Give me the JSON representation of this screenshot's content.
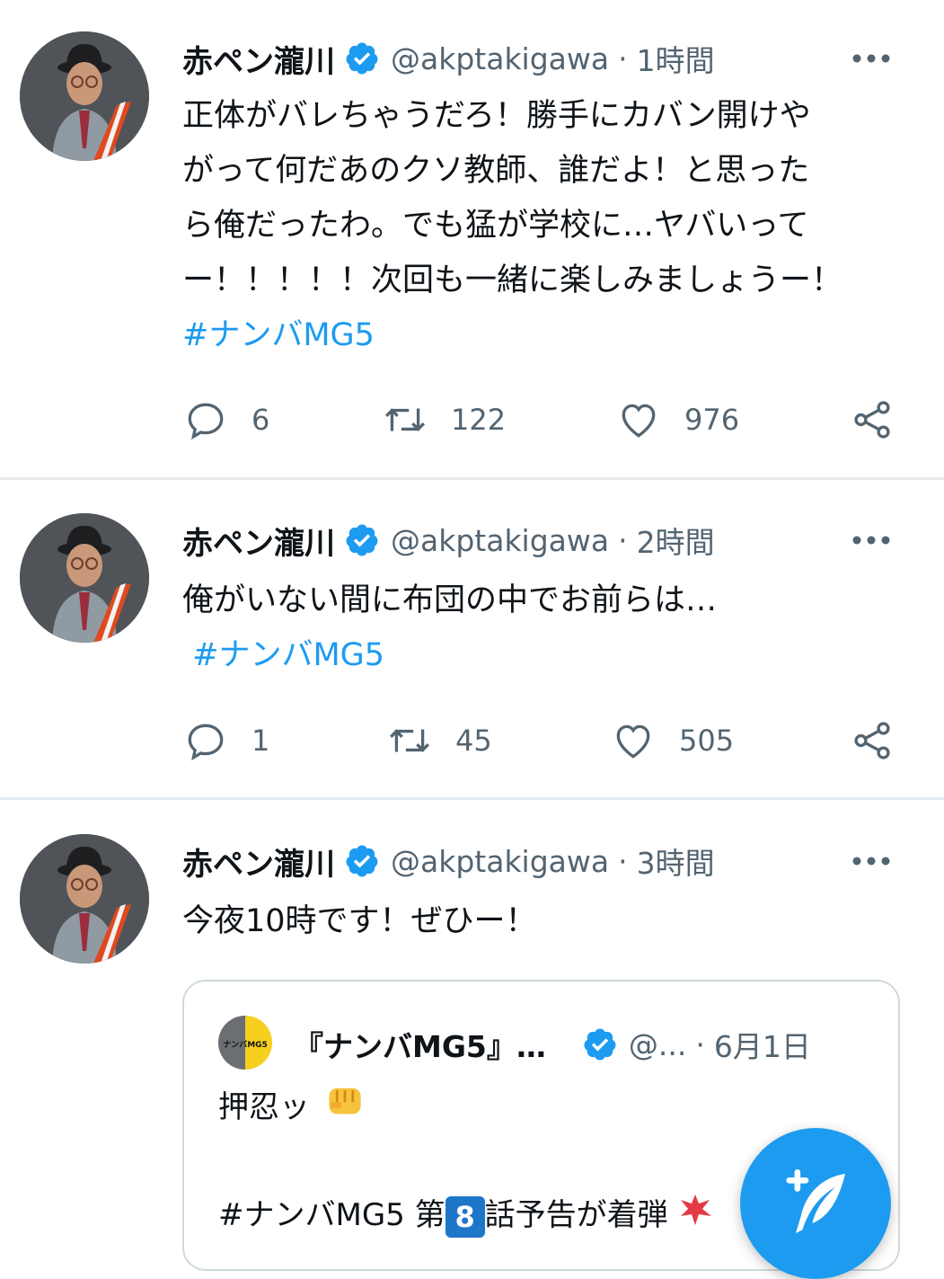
{
  "colors": {
    "accent": "#1d9bf0",
    "text": "#0f1419",
    "muted": "#536471",
    "divider": "#e6ecf0"
  },
  "tweets": [
    {
      "name": "赤ペン瀧川",
      "handle": "@akptakigawa",
      "sep": "·",
      "time": "1時間",
      "lines": [
        "正体がバレちゃうだろ！勝手にカバン開けや",
        "がって何だあのクソ教師、誰だよ！と思った",
        "ら俺だったわ。でも猛が学校に…ヤバいって",
        "ー！！！！！次回も一緒に楽しみましょうー！"
      ],
      "hashtag": "#ナンバMG5",
      "replies": "6",
      "retweets": "122",
      "likes": "976"
    },
    {
      "name": "赤ペン瀧川",
      "handle": "@akptakigawa",
      "sep": "·",
      "time": "2時間",
      "lines": [
        "俺がいない間に布団の中でお前らは…"
      ],
      "hashtag": " #ナンバMG5",
      "replies": "1",
      "retweets": "45",
      "likes": "505"
    },
    {
      "name": "赤ペン瀧川",
      "handle": "@akptakigawa",
      "sep": "·",
      "time": "3時間",
      "lines": [
        "今夜10時です！ぜひー！"
      ],
      "quote": {
        "name": "『ナンバMG5』…",
        "handle": "@...",
        "sep": "·",
        "time": "6月1日",
        "line1": "押忍ッ",
        "line2_prefix": "#ナンバMG5 第",
        "line2_number": "8",
        "line2_suffix": "話予告が着弾",
        "avatar_logo_text": "ナンバMG5"
      }
    }
  ],
  "icons": {
    "verified": "verified-badge-icon",
    "more": "more-horizontal-icon",
    "reply": "reply-bubble-icon",
    "retweet": "retweet-icon",
    "like": "heart-icon",
    "share": "share-icon",
    "compose": "compose-tweet-icon",
    "fist": "fist-emoji-icon",
    "collision": "collision-emoji-icon"
  }
}
